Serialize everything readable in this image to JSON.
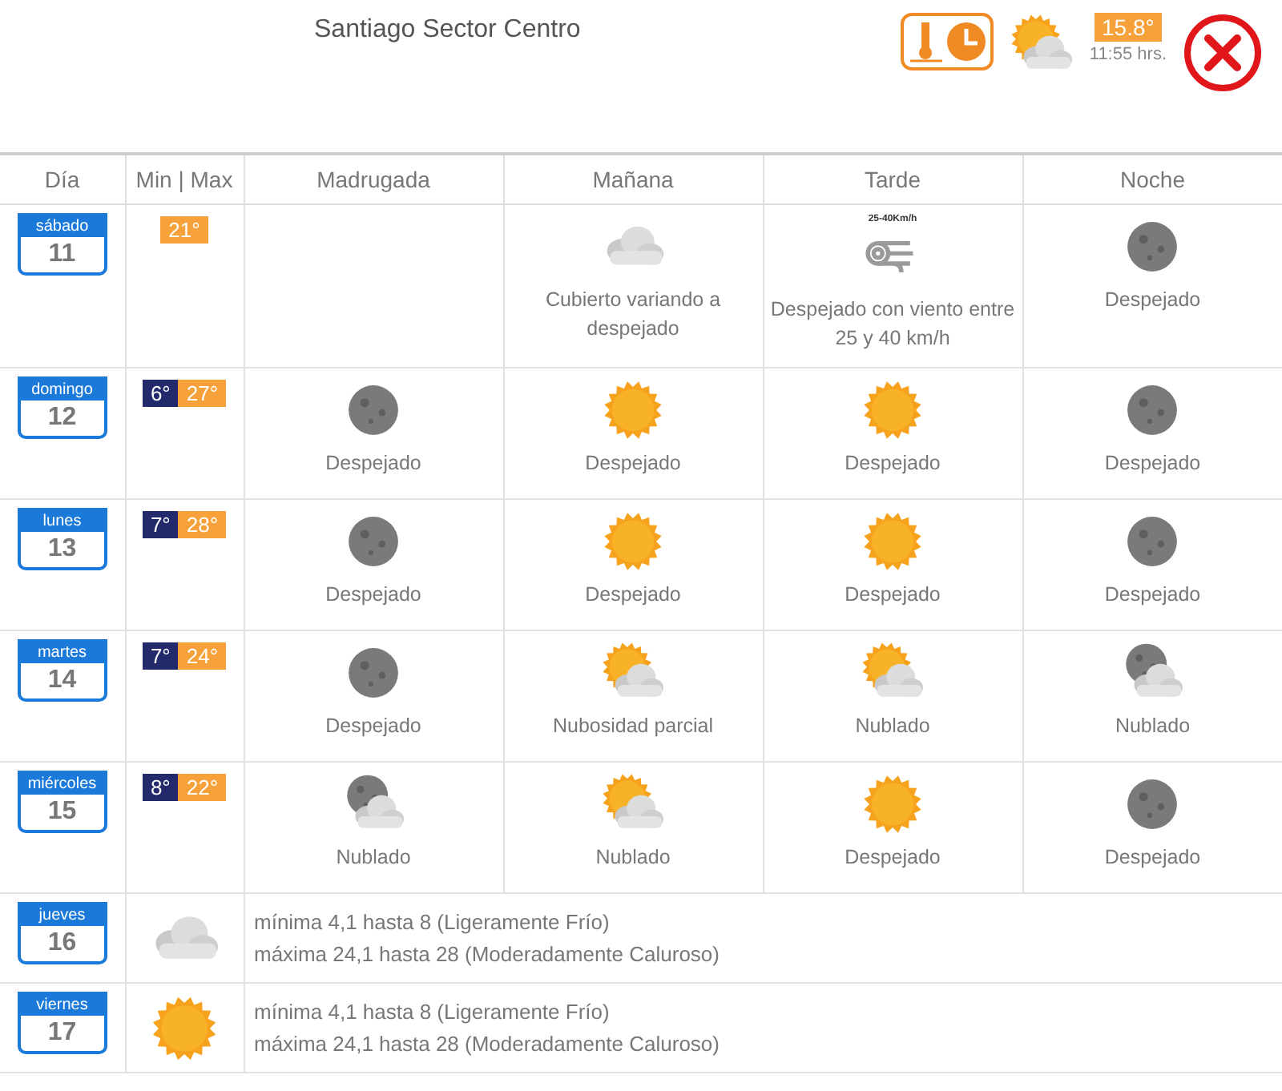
{
  "header": {
    "title": "Santiago Sector Centro",
    "current_temp": "15.8°",
    "time": "11:55 hrs.",
    "current_condition": {
      "kind": "sun-cloud"
    }
  },
  "table": {
    "columns": [
      "Día",
      "Min | Max",
      "Madrugada",
      "Mañana",
      "Tarde",
      "Noche"
    ],
    "rows": [
      {
        "kind": "periods",
        "weekday": "sábado",
        "day": "11",
        "max": "21°",
        "periods": [
          {
            "kind": "empty"
          },
          {
            "kind": "cloud",
            "text": "Cubierto variando a despejado"
          },
          {
            "kind": "wind",
            "icon_label": "25-40Km/h",
            "text": "Despejado con viento entre 25 y 40 km/h"
          },
          {
            "kind": "moon",
            "text": "Despejado"
          }
        ]
      },
      {
        "kind": "periods",
        "weekday": "domingo",
        "day": "12",
        "min": "6°",
        "max": "27°",
        "periods": [
          {
            "kind": "moon",
            "text": "Despejado"
          },
          {
            "kind": "sun",
            "text": "Despejado"
          },
          {
            "kind": "sun",
            "text": "Despejado"
          },
          {
            "kind": "moon",
            "text": "Despejado"
          }
        ]
      },
      {
        "kind": "periods",
        "weekday": "lunes",
        "day": "13",
        "min": "7°",
        "max": "28°",
        "periods": [
          {
            "kind": "moon",
            "text": "Despejado"
          },
          {
            "kind": "sun",
            "text": "Despejado"
          },
          {
            "kind": "sun",
            "text": "Despejado"
          },
          {
            "kind": "moon",
            "text": "Despejado"
          }
        ]
      },
      {
        "kind": "periods",
        "weekday": "martes",
        "day": "14",
        "min": "7°",
        "max": "24°",
        "periods": [
          {
            "kind": "moon",
            "text": "Despejado"
          },
          {
            "kind": "sun-cloud",
            "text": "Nubosidad parcial"
          },
          {
            "kind": "sun-cloud",
            "text": "Nublado"
          },
          {
            "kind": "moon-cloud",
            "text": "Nublado"
          }
        ]
      },
      {
        "kind": "periods",
        "weekday": "miércoles",
        "day": "15",
        "min": "8°",
        "max": "22°",
        "periods": [
          {
            "kind": "moon-cloud",
            "text": "Nublado"
          },
          {
            "kind": "sun-cloud",
            "text": "Nublado"
          },
          {
            "kind": "sun",
            "text": "Despejado"
          },
          {
            "kind": "moon",
            "text": "Despejado"
          }
        ]
      },
      {
        "kind": "summary",
        "weekday": "jueves",
        "day": "16",
        "condition": {
          "kind": "cloud"
        },
        "lines": [
          "mínima 4,1 hasta 8 (Ligeramente Frío)",
          "máxima 24,1 hasta 28 (Moderadamente Caluroso)"
        ]
      },
      {
        "kind": "summary",
        "weekday": "viernes",
        "day": "17",
        "condition": {
          "kind": "sun"
        },
        "lines": [
          "mínima 4,1 hasta 8 (Ligeramente Frío)",
          "máxima 24,1 hasta 28 (Moderadamente Caluroso)"
        ]
      }
    ]
  }
}
